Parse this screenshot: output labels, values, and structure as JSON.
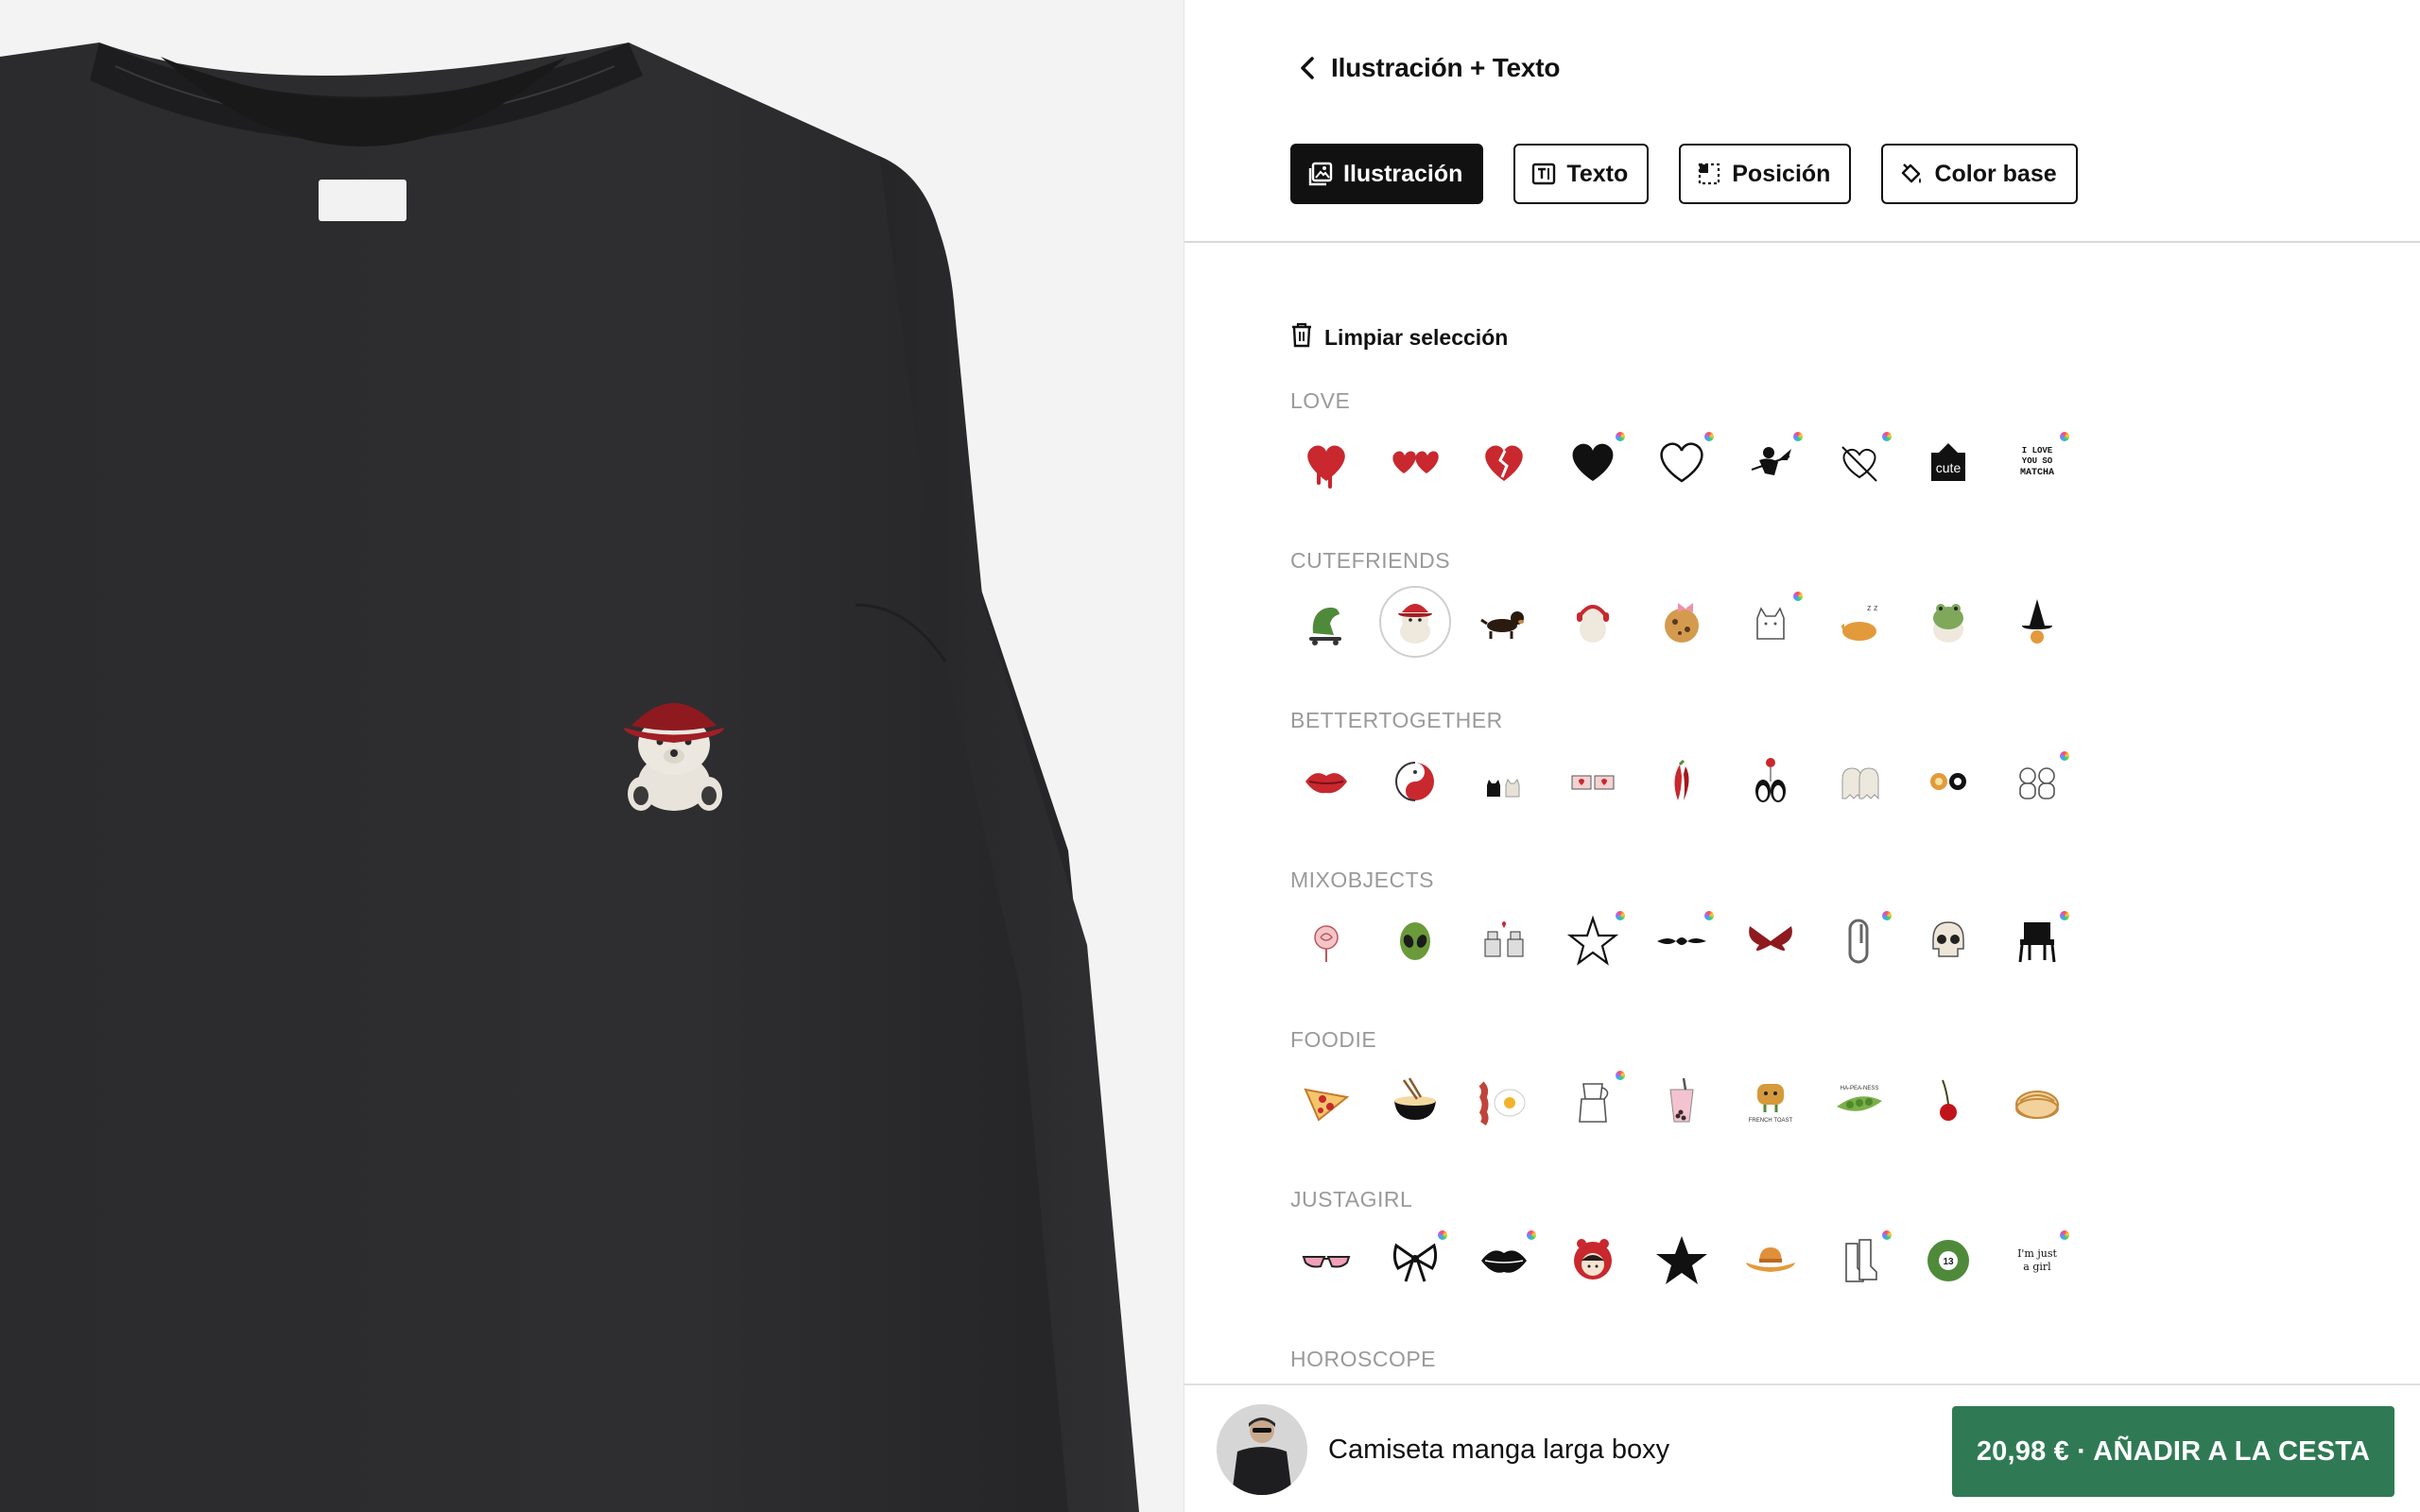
{
  "header": {
    "back_icon": "chevron-left-icon",
    "title": "Ilustración + Texto"
  },
  "tabs": [
    {
      "label": "Ilustración",
      "icon": "image-icon",
      "active": true
    },
    {
      "label": "Texto",
      "icon": "text-icon",
      "active": false
    },
    {
      "label": "Posición",
      "icon": "position-icon",
      "active": false
    },
    {
      "label": "Color base",
      "icon": "paint-bucket-icon",
      "active": false
    }
  ],
  "clear_selection": {
    "label": "Limpiar selección",
    "icon": "trash-icon"
  },
  "categories": [
    {
      "title": "LOVE",
      "items": [
        "dripping-heart",
        "double-hearts",
        "broken-heart",
        "black-heart",
        "outline-heart",
        "cupid",
        "arrow-heart",
        "cute-sign",
        "i-love-you-so-matcha"
      ],
      "item_texts": {
        "7": "cute",
        "8": "I LOVE YOU SO MATCHA"
      },
      "multicolor": [
        3,
        4,
        5,
        6,
        8
      ]
    },
    {
      "title": "CUTEFRIENDS",
      "items": [
        "dino-skater",
        "bear-bucket-hat",
        "dachshund",
        "puppy-headphones",
        "cookie-bow",
        "cat-line",
        "sleeping-chick",
        "frog-hat",
        "witch-hat"
      ],
      "selected": 1,
      "multicolor": [
        5
      ]
    },
    {
      "title": "BETTERTOGETHER",
      "items": [
        "lips-red",
        "yin-yang-koi",
        "two-cats",
        "puzzle-hearts",
        "chili-peppers",
        "penguins-balloon",
        "ghosts",
        "flowers-pair",
        "bears-hug"
      ],
      "multicolor": [
        8
      ]
    },
    {
      "title": "MIXOBJECTS",
      "items": [
        "rose",
        "alien",
        "robots-love",
        "star-outline",
        "tribal-line",
        "butterfly",
        "carabiner",
        "skull",
        "plastic-chair"
      ],
      "multicolor": [
        3,
        4,
        6,
        8
      ]
    },
    {
      "title": "FOODIE",
      "items": [
        "pizza",
        "ramen",
        "bacon-egg",
        "moka-pot",
        "bubble-tea",
        "french-toast",
        "peas",
        "cherry",
        "pie"
      ],
      "item_texts": {
        "5": "FRENCH TOAST",
        "6": "HA-PEA-NESS"
      },
      "multicolor": [
        3
      ]
    },
    {
      "title": "JUSTAGIRL",
      "items": [
        "sunglasses",
        "bow",
        "lips-kiss",
        "girl-red-hood",
        "star-black",
        "cowboy-hat",
        "boots",
        "ball-13",
        "im-just-a-girl"
      ],
      "item_texts": {
        "7": "13",
        "8": "I'm just a girl"
      },
      "multicolor": [
        1,
        2,
        6,
        8
      ]
    },
    {
      "title": "HOROSCOPE",
      "items": [],
      "multicolor": []
    }
  ],
  "bottom_bar": {
    "product_name": "Camiseta manga larga boxy",
    "add_to_cart": "20,98 € · AÑADIR A LA CESTA"
  },
  "colors": {
    "shirt": "#2a2a2c",
    "accent_green": "#2f7a55",
    "category_gray": "#9a9a9a"
  }
}
